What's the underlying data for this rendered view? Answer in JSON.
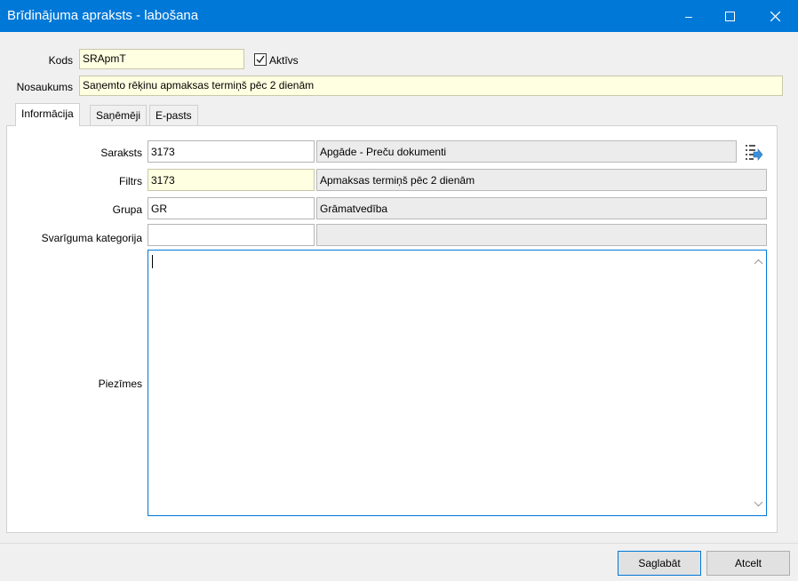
{
  "window": {
    "title": "Brīdinājuma apraksts - labošana",
    "minimize_icon": "minimize-icon",
    "maximize_icon": "maximize-icon",
    "close_icon": "close-icon"
  },
  "header": {
    "kods_label": "Kods",
    "kods_value": "SRApmT",
    "aktivs_label": "Aktīvs",
    "aktivs_checked": true,
    "nosaukums_label": "Nosaukums",
    "nosaukums_value": "Saņemto rēķinu apmaksas termiņš pēc 2 dienām"
  },
  "tabs": [
    {
      "label": "Informācija",
      "active": true
    },
    {
      "label": "Saņēmēji",
      "active": false
    },
    {
      "label": "E-pasts",
      "active": false
    }
  ],
  "form": {
    "saraksts_label": "Saraksts",
    "saraksts_code": "3173",
    "saraksts_desc": "Apgāde - Preču dokumenti",
    "filtrs_label": "Filtrs",
    "filtrs_code": "3173",
    "filtrs_desc": "Apmaksas termiņš pēc 2 dienām",
    "grupa_label": "Grupa",
    "grupa_code": "GR",
    "grupa_desc": "Grāmatvedība",
    "svarigums_label": "Svarīguma kategorija",
    "svarigums_code": "",
    "svarigums_desc": "",
    "piezimes_label": "Piezīmes",
    "piezimes_value": ""
  },
  "footer": {
    "save_label": "Saglabāt",
    "cancel_label": "Atcelt"
  },
  "colors": {
    "titlebar": "#0078d7",
    "required_field": "#ffffe1",
    "readonly_field": "#ececec"
  }
}
